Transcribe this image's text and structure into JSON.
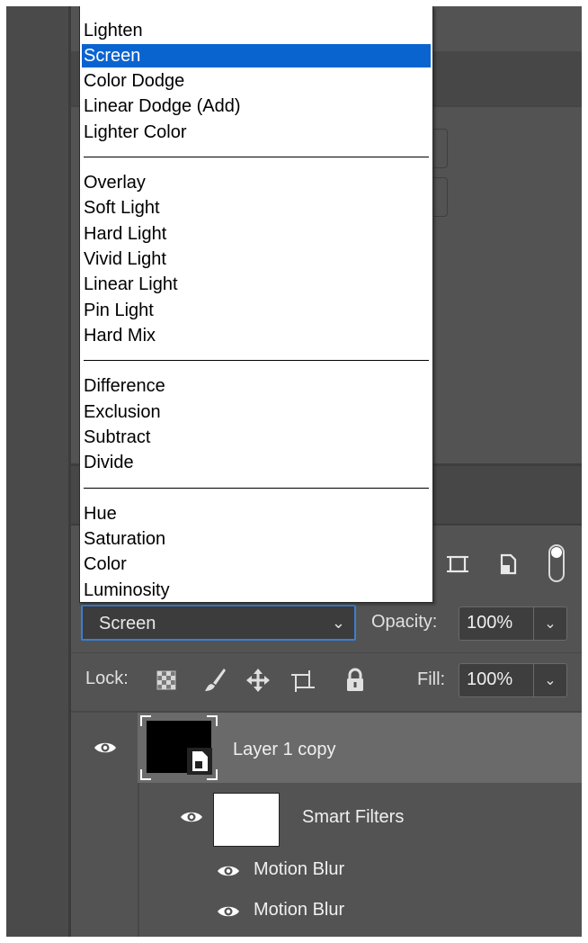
{
  "blend_menu": {
    "groups": [
      [
        "Lighten",
        "Screen",
        "Color Dodge",
        "Linear Dodge (Add)",
        "Lighter Color"
      ],
      [
        "Overlay",
        "Soft Light",
        "Hard Light",
        "Vivid Light",
        "Linear Light",
        "Pin Light",
        "Hard Mix"
      ],
      [
        "Difference",
        "Exclusion",
        "Subtract",
        "Divide"
      ],
      [
        "Hue",
        "Saturation",
        "Color",
        "Luminosity"
      ]
    ],
    "selected": "Screen",
    "highlight_color": "#0a64d0"
  },
  "layers_panel": {
    "blend_mode_value": "Screen",
    "opacity_label": "Opacity:",
    "opacity_value": "100%",
    "lock_label": "Lock:",
    "fill_label": "Fill:",
    "fill_value": "100%",
    "layers": [
      {
        "name": "Layer 1 copy",
        "selected": true
      },
      {
        "name": "Smart Filters"
      },
      {
        "name": "Motion Blur"
      },
      {
        "name": "Motion Blur"
      }
    ]
  },
  "icons": [
    "artboard-icon",
    "document-icon",
    "toggle-switch",
    "checkerboard-lock-icon",
    "brush-lock-icon",
    "move-lock-icon",
    "artboard-lock-icon",
    "padlock-icon",
    "eye-icon",
    "chevron-down-icon"
  ]
}
